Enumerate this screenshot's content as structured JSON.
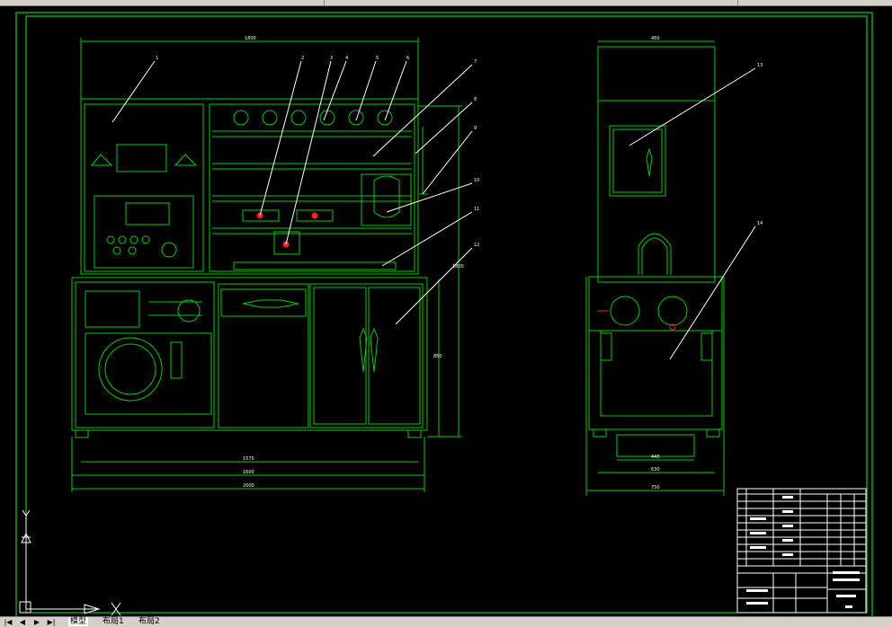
{
  "colors": {
    "background": "#000000",
    "frame": "#00ff00",
    "outline": "#00cc00",
    "annotation": "#ffffff",
    "accent_red": "#ff2020"
  },
  "drawing": {
    "front_view": {
      "overall_width_top": "1800",
      "width_bottom_1": "1570",
      "width_bottom_2": "1600",
      "width_bottom_3": "2000",
      "height_total": "1800",
      "height_lower": "850",
      "callouts": [
        "1",
        "2",
        "3",
        "4",
        "5",
        "6",
        "7",
        "8",
        "9",
        "10",
        "11",
        "12"
      ]
    },
    "side_view": {
      "top_width": "460",
      "base_inner_width": "440",
      "base_width": "630",
      "overall_width": "750",
      "callouts": [
        "13",
        "14"
      ]
    }
  },
  "ucs_icon": {
    "x_label": "X",
    "y_label": "Y"
  },
  "layout_tabs": {
    "nav_icons": [
      "first-page-icon",
      "prev-page-icon",
      "next-page-icon",
      "last-page-icon"
    ],
    "tabs": [
      "模型",
      "布局1",
      "布局2"
    ],
    "active": "模型"
  }
}
